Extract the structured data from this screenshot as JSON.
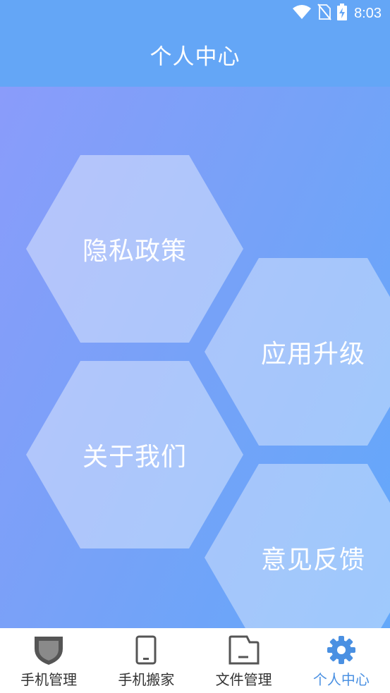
{
  "status_bar": {
    "time": "8:03",
    "icons": [
      "wifi-icon",
      "no-sim-icon",
      "battery-charging-icon"
    ]
  },
  "header": {
    "title": "个人中心"
  },
  "menu": {
    "privacy_policy": "隐私政策",
    "app_upgrade": "应用升级",
    "about_us": "关于我们",
    "feedback": "意见反馈"
  },
  "bottom_nav": {
    "items": [
      {
        "label": "手机管理",
        "icon": "shield-icon"
      },
      {
        "label": "手机搬家",
        "icon": "phone-icon"
      },
      {
        "label": "文件管理",
        "icon": "folder-icon"
      },
      {
        "label": "个人中心",
        "icon": "gear-icon"
      }
    ],
    "active_index": 3
  },
  "colors": {
    "header_bg": "#64a6f6",
    "active_nav": "#4a90e2",
    "inactive_nav": "#333333",
    "icon_gray": "#555555"
  }
}
